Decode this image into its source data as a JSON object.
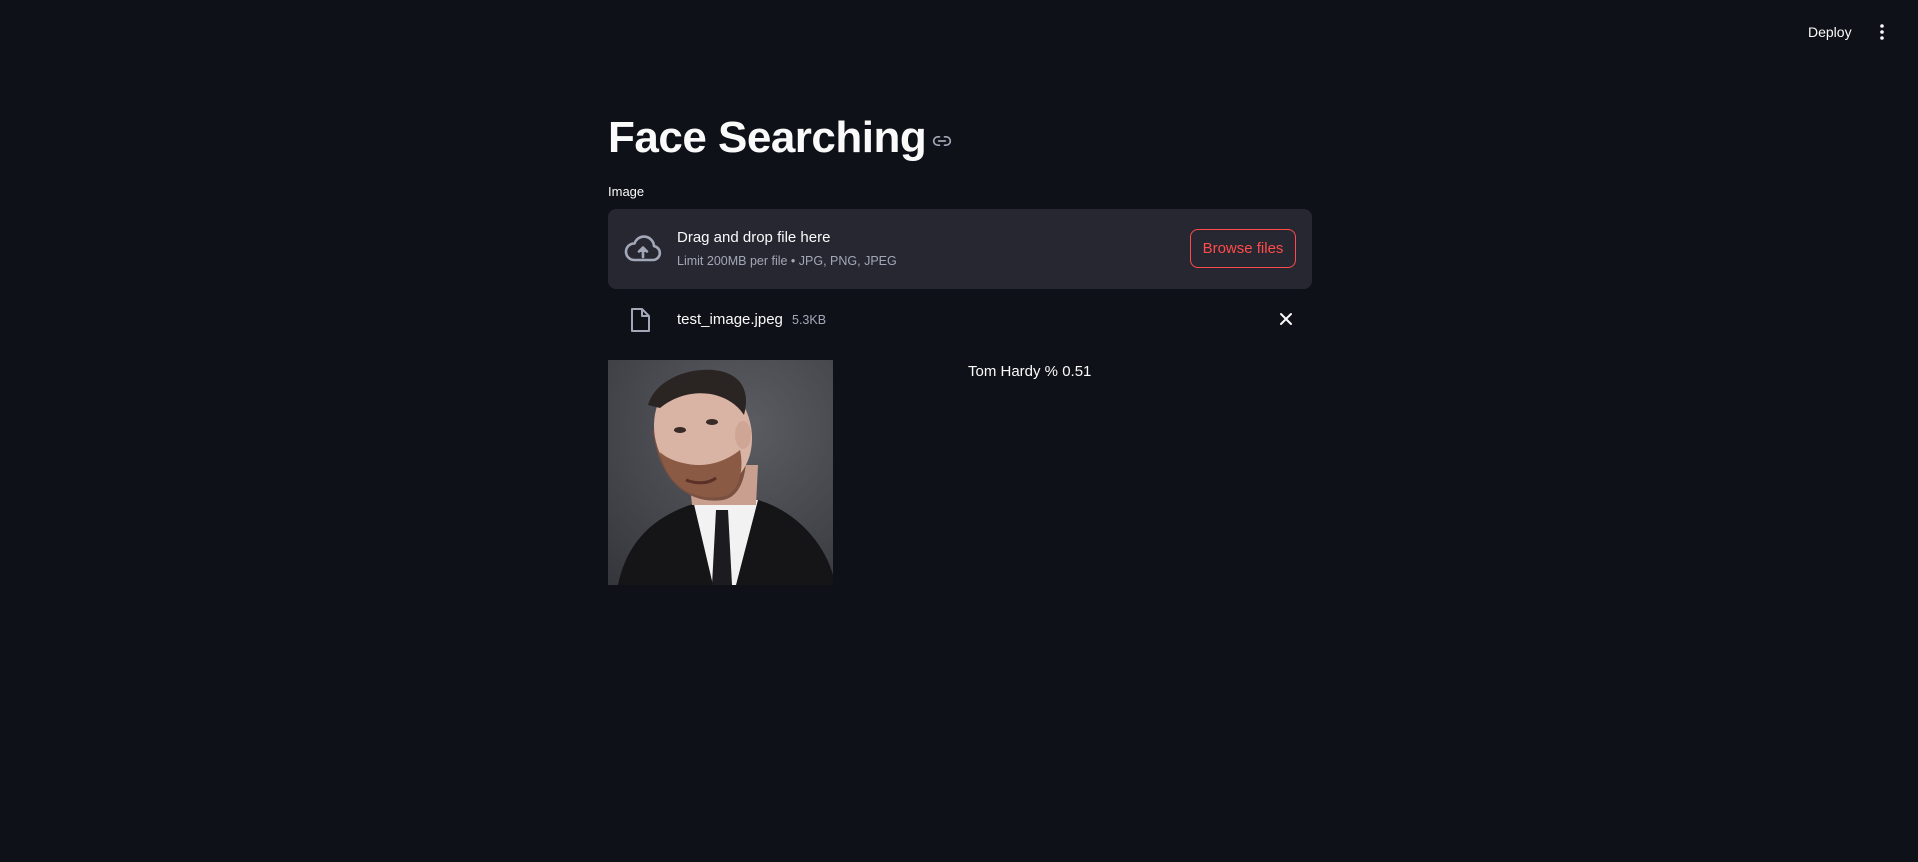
{
  "header": {
    "deploy_label": "Deploy",
    "menu_icon": "kebab-menu-icon"
  },
  "main": {
    "title": "Face Searching",
    "uploader": {
      "label": "Image",
      "dropzone_title": "Drag and drop file here",
      "dropzone_limit": "Limit 200MB per file • JPG, PNG, JPEG",
      "browse_label": "Browse files",
      "accent_color": "#ff4b4b"
    },
    "uploaded_file": {
      "name": "test_image.jpeg",
      "size": "5.3KB"
    },
    "result": {
      "text": "Tom Hardy % 0.51"
    }
  },
  "colors": {
    "background": "#0e1117",
    "surface": "#262730",
    "text": "#fafafa",
    "muted": "#a3a8b8"
  }
}
